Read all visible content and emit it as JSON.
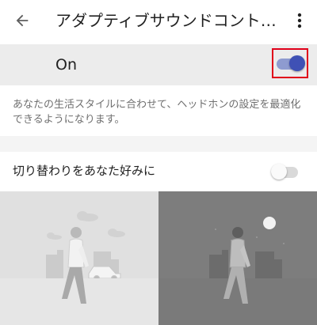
{
  "app_bar": {
    "title": "アダプティブサウンドコント…",
    "back_icon": "arrow-back-icon",
    "more_icon": "more-vert-icon"
  },
  "master": {
    "label": "On",
    "enabled": true,
    "accent_color": "#3f51b5",
    "highlight_color": "#e0001a"
  },
  "description": "あなたの生活スタイルに合わせて、ヘッドホンの設定を最適化できるようになります。",
  "auto_switch": {
    "label": "切り替わりをあなた好みに",
    "enabled": false
  },
  "illustrations": [
    {
      "scene": "day-city-person-walking"
    },
    {
      "scene": "night-city-person-walking"
    }
  ]
}
